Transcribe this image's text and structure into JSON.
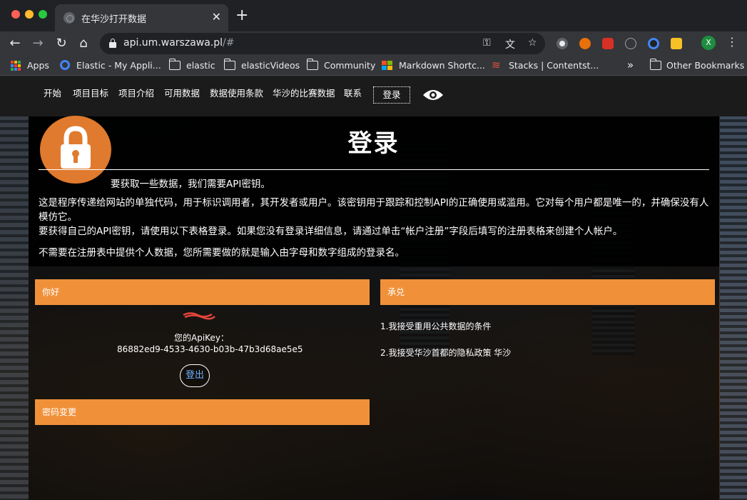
{
  "browser": {
    "tab": {
      "title": "在华沙打开数据"
    },
    "address_bar": {
      "domain": "api.um.warszawa.pl",
      "path": "/#"
    },
    "profile_initial": "X",
    "bookmarks": [
      {
        "label": "Apps"
      },
      {
        "label": "Elastic - My Appli..."
      },
      {
        "label": "elastic"
      },
      {
        "label": "elasticVideos"
      },
      {
        "label": "Community"
      },
      {
        "label": "Markdown Shortc..."
      },
      {
        "label": "Stacks | Contentst..."
      }
    ],
    "overflow": "»",
    "other_bookmarks": "Other Bookmarks",
    "colors": {
      "frame": "#202124",
      "toolbar": "#35363a"
    }
  },
  "site_nav": {
    "items": [
      "开始",
      "项目目标",
      "项目介绍",
      "可用数据",
      "数据使用条款",
      "华沙的比赛数据",
      "联系"
    ],
    "login": "登录"
  },
  "page": {
    "title": "登录",
    "lead": "要获取一些数据，我们需要API密钥。",
    "paragraphs": [
      "这是程序传递给网站的单独代码，用于标识调用者，其开发者或用户。该密钥用于跟踪和控制API的正确使用或滥用。它对每个用户都是唯一的，并确保没有人模仿它。",
      "要获得自己的API密钥，请使用以下表格登录。如果您没有登录详细信息，请通过单击“帐户注册”字段后填写的注册表格来创建个人帐户。",
      "不需要在注册表中提供个人数据，您所需要做的就是输入由字母和数字组成的登录名。"
    ],
    "hello_header": "你好",
    "api_key_label": "您的ApiKey：",
    "api_key": "86882ed9-4533-4630-b03b-47b3d68ae5e5",
    "logout": "登出",
    "password_header": "密码变更",
    "accept_header": "承兑",
    "terms": [
      "1.我接受重用公共数据的条件",
      "2.我接受华沙首都的隐私政策 华沙"
    ],
    "colors": {
      "accent": "#f0913a",
      "badge": "#e07a2e",
      "link": "#6fb0ff"
    }
  }
}
